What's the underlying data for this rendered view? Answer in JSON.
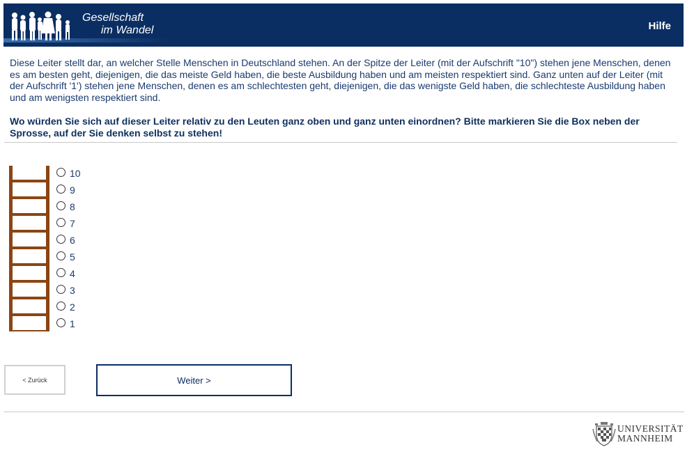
{
  "header": {
    "title_line1": "Gesellschaft",
    "title_line2": "im Wandel",
    "help_label": "Hilfe",
    "background": "#0a2d62"
  },
  "intro_text": "Diese Leiter stellt dar, an welcher Stelle Menschen in Deutschland stehen. An der Spitze der Leiter (mit der Aufschrift \"10\") stehen jene Menschen, denen es am besten geht, diejenigen, die das meiste Geld haben, die beste Ausbildung haben und am meisten respektiert sind. Ganz unten auf der Leiter (mit der Aufschrift '1') stehen jene Menschen, denen es am schlechtesten geht, diejenigen, die das wenigste Geld haben, die schlechteste Ausbildung haben und am wenigsten respektiert sind.",
  "question_text": "Wo würden Sie sich auf dieser Leiter relativ zu den Leuten ganz oben und ganz unten einordnen? Bitte markieren Sie die Box neben der Sprosse, auf der Sie denken selbst zu stehen!",
  "ladder": {
    "color": "#8b4513",
    "selected": null
  },
  "options": [
    "10",
    "9",
    "8",
    "7",
    "6",
    "5",
    "4",
    "3",
    "2",
    "1"
  ],
  "buttons": {
    "back": "< Zurück",
    "next": "Weiter >"
  },
  "footer": {
    "uni_line1": "UNIVERSITÄT",
    "uni_line2": "MANNHEIM"
  }
}
